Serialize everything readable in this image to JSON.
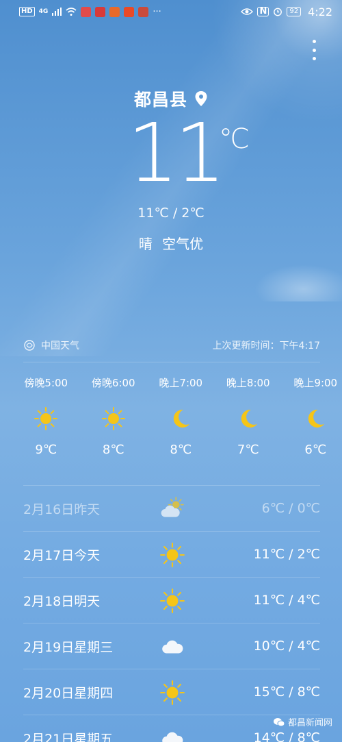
{
  "status_bar": {
    "network": "HD",
    "signal": "4G",
    "battery": "92",
    "time": "4:22"
  },
  "location": {
    "city": "都昌县"
  },
  "current": {
    "temp": "11",
    "unit": "℃",
    "hi_lo": "11℃ / 2℃",
    "condition": "晴",
    "air_quality": "空气优"
  },
  "source": {
    "provider": "中国天气",
    "updated": "上次更新时间：下午4:17"
  },
  "hourly": [
    {
      "label": "傍晚5:00",
      "icon": "sun-icon",
      "temp": "9℃"
    },
    {
      "label": "傍晚6:00",
      "icon": "sun-icon",
      "temp": "8℃"
    },
    {
      "label": "晚上7:00",
      "icon": "moon-icon",
      "temp": "8℃"
    },
    {
      "label": "晚上8:00",
      "icon": "moon-icon",
      "temp": "7℃"
    },
    {
      "label": "晚上9:00",
      "icon": "moon-icon",
      "temp": "6℃"
    }
  ],
  "daily": [
    {
      "date": "2月16日昨天",
      "icon": "partly-cloudy-icon",
      "temp": "6℃ / 0℃",
      "past": true
    },
    {
      "date": "2月17日今天",
      "icon": "sun-icon",
      "temp": "11℃ / 2℃",
      "past": false
    },
    {
      "date": "2月18日明天",
      "icon": "sun-icon",
      "temp": "11℃ / 4℃",
      "past": false
    },
    {
      "date": "2月19日星期三",
      "icon": "cloud-icon",
      "temp": "10℃ / 4℃",
      "past": false
    },
    {
      "date": "2月20日星期四",
      "icon": "sun-icon",
      "temp": "15℃ / 8℃",
      "past": false
    },
    {
      "date": "2月21日星期五",
      "icon": "cloud-icon",
      "temp": "14℃ / 8℃",
      "past": false
    }
  ],
  "watermark": "都昌新闻网",
  "colors": {
    "sun": "#f5c518",
    "moon": "#f5c518",
    "background_top": "#4f8fcf",
    "background_bottom": "#6aa4df"
  }
}
